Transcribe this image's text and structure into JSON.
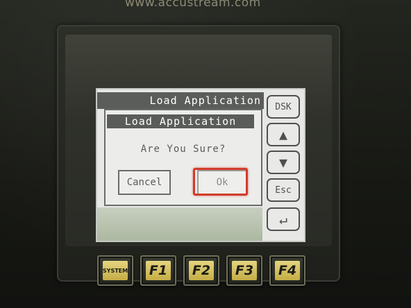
{
  "brand_url": "www.accustream.com",
  "screen": {
    "title": "Load Application",
    "side_buttons": {
      "dsk": "DSK",
      "up_icon": "▲",
      "down_icon": "▼",
      "esc": "Esc",
      "enter_icon": "↵"
    }
  },
  "dialog": {
    "title": "Load Application",
    "message": "Are You Sure?",
    "cancel_label": "Cancel",
    "ok_label": "Ok"
  },
  "function_keys": [
    {
      "label": "SYSTEM"
    },
    {
      "label": "F1"
    },
    {
      "label": "F2"
    },
    {
      "label": "F3"
    },
    {
      "label": "F4"
    }
  ],
  "colors": {
    "highlight": "#d23b2a",
    "key_face": "#d9c660",
    "lcd_background": "#e7e8e6"
  }
}
